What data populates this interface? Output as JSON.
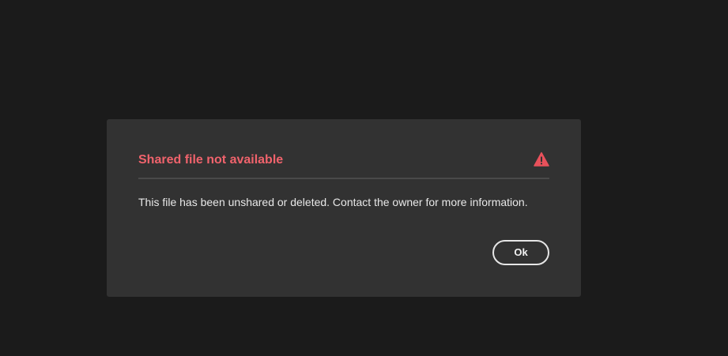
{
  "dialog": {
    "title": "Shared file not available",
    "message": "This file has been unshared or deleted. Contact the owner for more information.",
    "ok_label": "Ok",
    "icon": "alert-icon"
  },
  "colors": {
    "background": "#1b1b1b",
    "dialog_background": "#323232",
    "title": "#f0636c",
    "alert": "#e8515b",
    "text": "#e8e8e8"
  }
}
